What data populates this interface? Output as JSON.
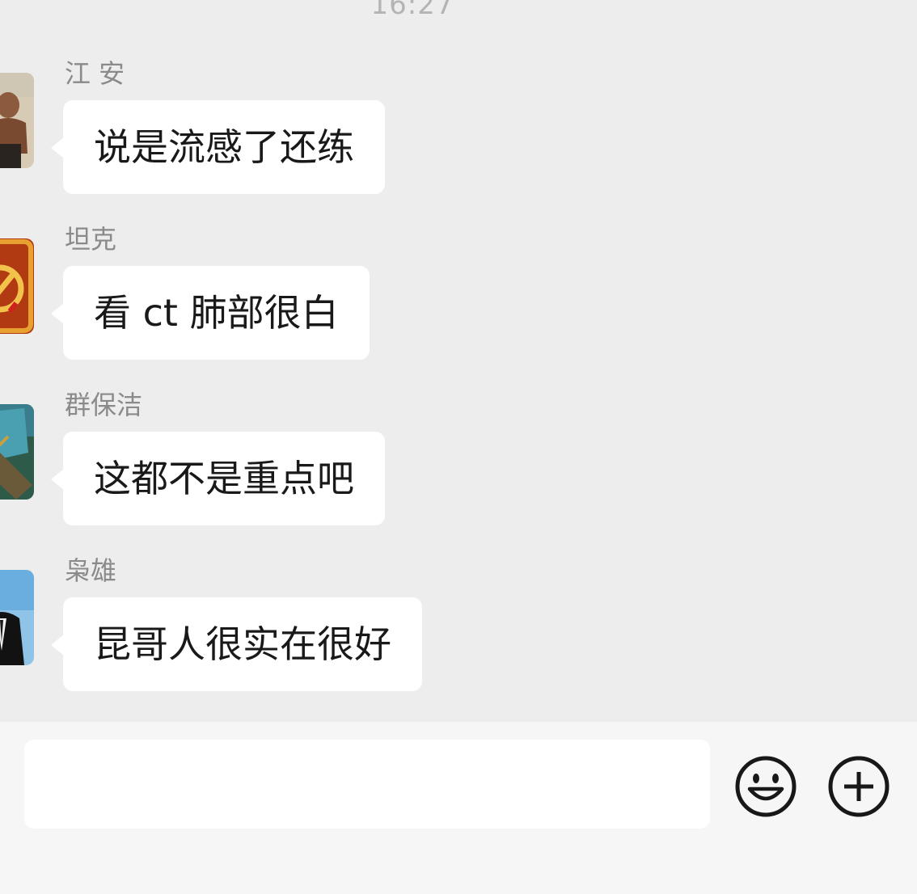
{
  "chat": {
    "timestamp": "16:27",
    "messages": [
      {
        "sender": "江 安",
        "text": "说是流感了还练"
      },
      {
        "sender": "坦克",
        "text": "看 ct 肺部很白"
      },
      {
        "sender": "群保洁",
        "text": "这都不是重点吧"
      },
      {
        "sender": "枭雄",
        "text": "昆哥人很实在很好"
      }
    ]
  },
  "input_bar": {
    "input_value": "",
    "emoji_icon": "emoji-icon",
    "add_icon": "plus-circle-icon"
  },
  "colors": {
    "chat_background": "#ededed",
    "bubble": "#ffffff",
    "input_bar_background": "#f6f6f6",
    "icon_stroke": "#181818"
  }
}
